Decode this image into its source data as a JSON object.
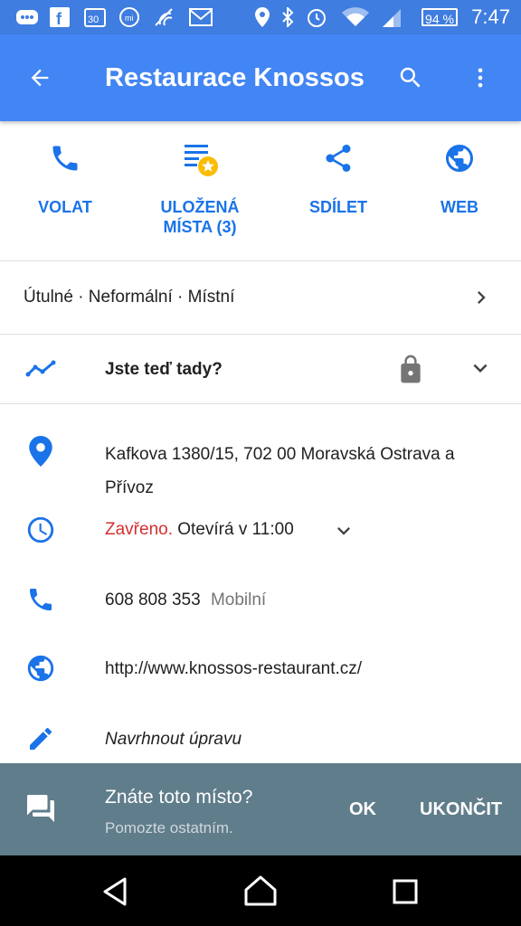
{
  "status_bar": {
    "time": "7:47",
    "battery": "94 %"
  },
  "app_bar": {
    "title": "Restaurace Knossos"
  },
  "actions": [
    {
      "label": "VOLAT",
      "icon": "phone-icon"
    },
    {
      "label": "ULOŽENÁ\nMÍSTA (3)",
      "icon": "saved-places-icon"
    },
    {
      "label": "SDÍLET",
      "icon": "share-icon"
    },
    {
      "label": "WEB",
      "icon": "globe-icon"
    }
  ],
  "tags": "Útulné · Neformální · Místní",
  "presence": {
    "question": "Jste teď tady?"
  },
  "details": {
    "address": "Kafkova 1380/15, 702 00 Moravská Ostrava a Přívoz",
    "hours_status": "Zavřeno.",
    "hours_text": "Otevírá v 11:00",
    "phone": "608 808 353",
    "phone_type": "Mobilní",
    "website": "http://www.knossos-restaurant.cz/",
    "suggest_edit": "Navrhnout úpravu"
  },
  "snackbar": {
    "question": "Znáte toto místo?",
    "subtitle": "Pomozte ostatním.",
    "ok": "OK",
    "dismiss": "UKONČIT"
  },
  "colors": {
    "primary": "#4285f4",
    "accent_blue": "#1a73e8",
    "closed_red": "#d32f2f",
    "snackbar": "#607d8b"
  }
}
